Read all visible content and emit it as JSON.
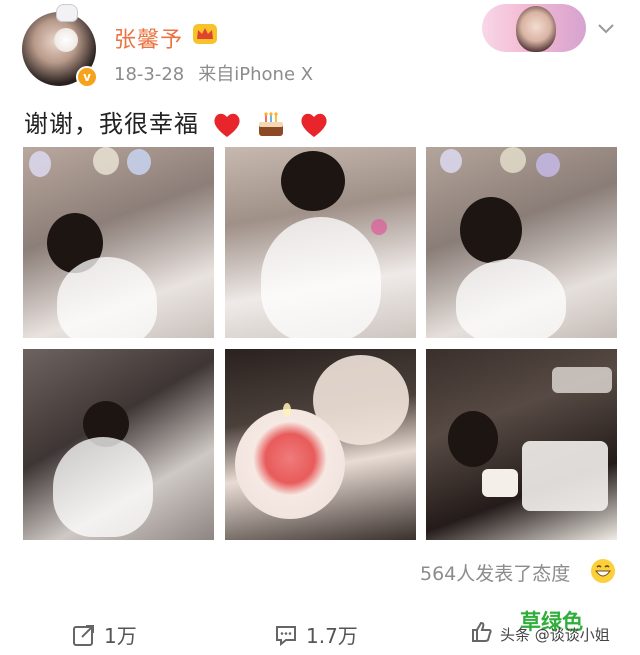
{
  "header": {
    "username": "张馨予",
    "date": "18-3-28",
    "source": "来自iPhone X",
    "avatar_badge": "v"
  },
  "post": {
    "text": "谢谢，我很幸福",
    "emojis": [
      "heart-icon",
      "cake-icon",
      "heart-icon"
    ],
    "photos": [
      {
        "name": "photo-1"
      },
      {
        "name": "photo-2"
      },
      {
        "name": "photo-3"
      },
      {
        "name": "photo-4"
      },
      {
        "name": "photo-5"
      },
      {
        "name": "photo-6"
      }
    ]
  },
  "reactions": {
    "label": "564人发表了态度"
  },
  "toolbar": {
    "repost_count": "1万",
    "comment_count": "1.7万",
    "like_count": ""
  },
  "watermark": {
    "main": "草绿色",
    "sub": "头条 @谈谈小姐"
  },
  "colors": {
    "username": "#eb7340",
    "meta": "#8c8c8c",
    "watermark": "#2fae3a",
    "badge": "#f7a21b"
  }
}
